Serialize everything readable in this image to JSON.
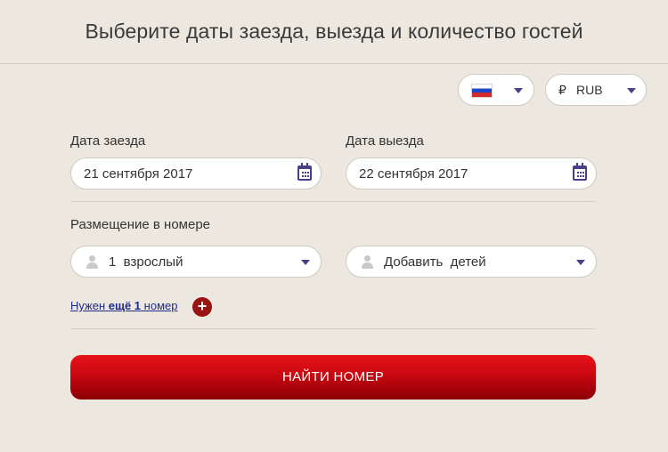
{
  "header": {
    "title": "Выберите даты заезда, выезда и количество гостей"
  },
  "language": {
    "flag_icon": "russia-flag-icon"
  },
  "currency": {
    "symbol": "₽",
    "code": "RUB"
  },
  "checkin": {
    "label": "Дата заезда",
    "value": "21 сентября 2017"
  },
  "checkout": {
    "label": "Дата выезда",
    "value": "22 сентября 2017"
  },
  "accommodation": {
    "label": "Размещение в номере",
    "adults": "1  взрослый",
    "children": "Добавить  детей"
  },
  "add_room": {
    "prefix": "Нужен ",
    "bold": "ещё 1",
    "suffix": " номер",
    "plus": "+"
  },
  "search_button": {
    "label": "НАЙТИ НОМЕР"
  },
  "colors": {
    "accent": "#4a3f86",
    "button": "#c90710",
    "background": "#ede8df"
  }
}
